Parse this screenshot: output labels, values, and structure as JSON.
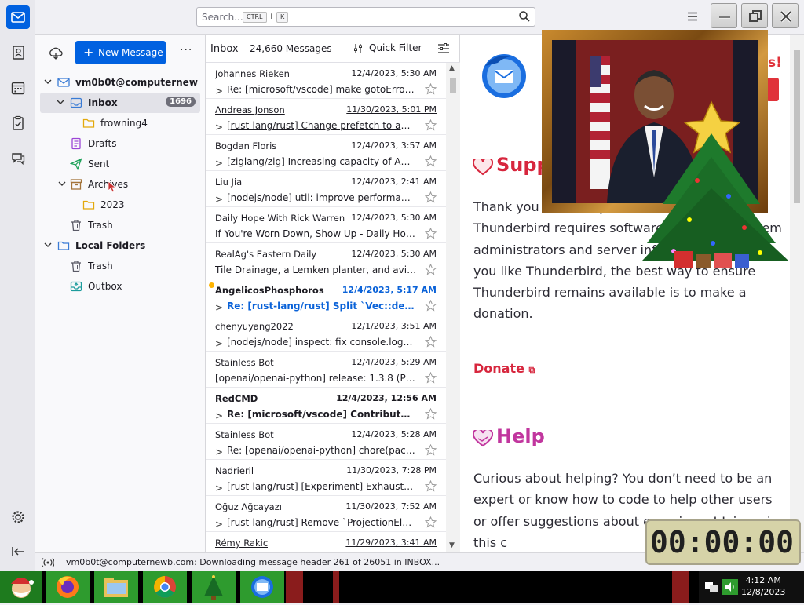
{
  "search": {
    "placeholder": "Search...",
    "key1": "CTRL",
    "plus": "+",
    "key2": "K"
  },
  "toolbar": {
    "new_message": "New Message",
    "more": "···"
  },
  "folders": {
    "account": "vm0b0t@computernewb....",
    "inbox": "Inbox",
    "inbox_count": "1696",
    "frowning": "frowning4",
    "drafts": "Drafts",
    "sent": "Sent",
    "archives": "Archives",
    "year": "2023",
    "trash": "Trash",
    "local": "Local Folders",
    "local_trash": "Trash",
    "outbox": "Outbox"
  },
  "list": {
    "title": "Inbox",
    "count": "24,660 Messages",
    "quick_filter": "Quick Filter",
    "messages": [
      {
        "from": "Johannes Rieken",
        "date": "12/4/2023, 5:30 AM",
        "subject": "Re: [microsoft/vscode] make gotoError..."
      },
      {
        "from": "Andreas Jonson",
        "date": "11/30/2023, 5:01 PM",
        "subject": "[rust-lang/rust] Change prefetch to avoi..."
      },
      {
        "from": "Bogdan Floris",
        "date": "12/4/2023, 3:57 AM",
        "subject": "[ziglang/zig] Increasing capacity of Auto..."
      },
      {
        "from": "Liu Jia",
        "date": "12/4/2023, 2:41 AM",
        "subject": "[nodejs/node] util: improve performanc..."
      },
      {
        "from": "Daily Hope With Rick Warren",
        "date": "12/4/2023, 5:30 AM",
        "subject": "If You're Worn Down, Show Up - Daily Hop..."
      },
      {
        "from": "RealAg's Eastern Daily",
        "date": "12/4/2023, 5:30 AM",
        "subject": "Tile Drainage, a Lemken planter, and aviati..."
      },
      {
        "from": "AngelicosPhosphoros",
        "date": "12/4/2023, 5:17 AM",
        "subject": "Re: [rust-lang/rust] Split `Vec::dedup_..."
      },
      {
        "from": "chenyuyang2022",
        "date": "12/1/2023, 3:51 AM",
        "subject": "[nodejs/node] inspect: fix console.log(%..."
      },
      {
        "from": "Stainless Bot",
        "date": "12/4/2023, 5:29 AM",
        "subject": "[openai/openai-python] release: 1.3.8 (PR ..."
      },
      {
        "from": "RedCMD",
        "date": "12/4/2023, 12:56 AM",
        "subject": "Re: [microsoft/vscode] Contribute to ..."
      },
      {
        "from": "Stainless Bot",
        "date": "12/4/2023, 5:28 AM",
        "subject": "Re: [openai/openai-python] chore(packa..."
      },
      {
        "from": "Nadrieril",
        "date": "11/30/2023, 7:28 PM",
        "subject": "[rust-lang/rust] [Experiment] Exhaustiven..."
      },
      {
        "from": "Oğuz Ağcayazı",
        "date": "11/30/2023, 7:52 AM",
        "subject": "[rust-lang/rust] Remove `ProjectionElem:..."
      },
      {
        "from": "Rémy Rakic",
        "date": "11/29/2023, 3:41 AM",
        "subject": ""
      }
    ]
  },
  "reader": {
    "support_heading": "Supp",
    "support_text": "Thank you     funded by users like you! P     Thunderbird requires software     designers, system administrators and server infrastructure. So if you like Thunderbird, the best way to ensure Thunderbird remains available is to make a donation.",
    "exclaim": "s!",
    "donate": "Donate",
    "help_heading": "Help",
    "help_text": "Curious about helping? You don’t need to be an expert or know how to code to help other users or offer suggestions about               experience! Join us in this c"
  },
  "timer": {
    "value": "00:00:00"
  },
  "status": {
    "text": "vm0b0t@computernewb.com: Downloading message header 261 of 26051 in INBOX..."
  },
  "clock": {
    "time": "4:12 AM",
    "date": "12/8/2023"
  },
  "colors": {
    "accent": "#0061e0",
    "support": "#d7263d",
    "help": "#c1369e"
  }
}
